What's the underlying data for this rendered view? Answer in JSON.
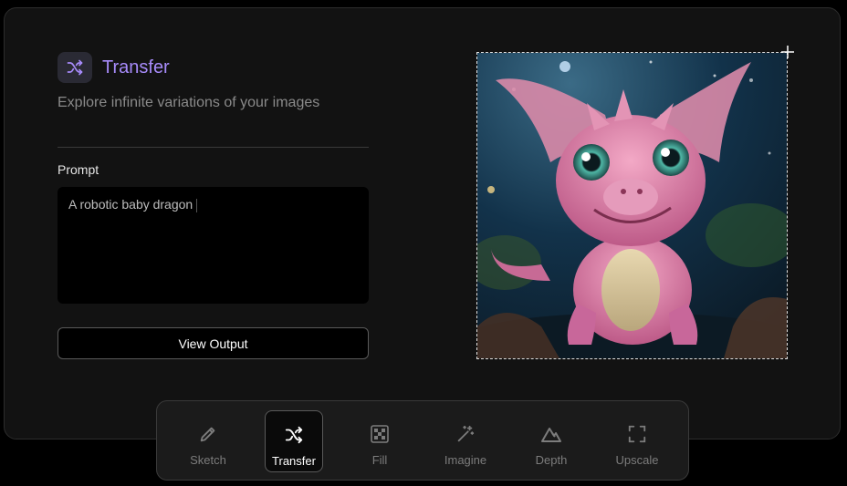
{
  "header": {
    "title": "Transfer",
    "subtitle": "Explore infinite variations of your images",
    "icon": "shuffle-icon",
    "accent": "#a78bfa"
  },
  "prompt": {
    "label": "Prompt",
    "value": "A robotic baby dragon"
  },
  "actions": {
    "view_output_label": "View Output"
  },
  "preview": {
    "subject": "pink baby dragon image"
  },
  "toolbar": {
    "items": [
      {
        "label": "Sketch",
        "icon": "pencil-icon",
        "active": false
      },
      {
        "label": "Transfer",
        "icon": "shuffle-icon",
        "active": true
      },
      {
        "label": "Fill",
        "icon": "checkerboard-icon",
        "active": false
      },
      {
        "label": "Imagine",
        "icon": "magic-wand-icon",
        "active": false
      },
      {
        "label": "Depth",
        "icon": "mountain-icon",
        "active": false
      },
      {
        "label": "Upscale",
        "icon": "expand-corners-icon",
        "active": false
      }
    ]
  }
}
